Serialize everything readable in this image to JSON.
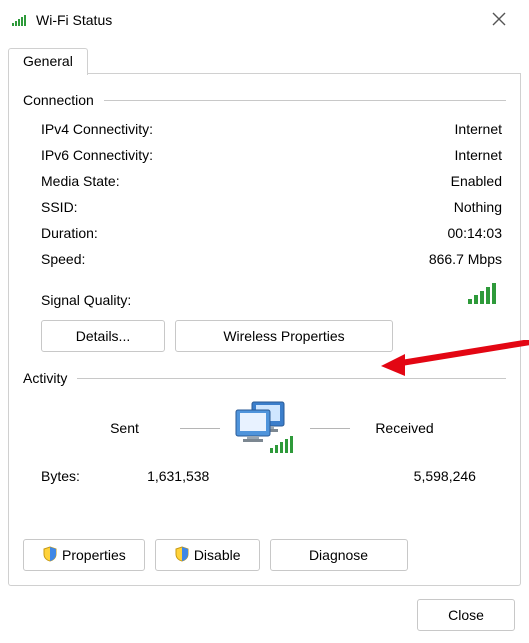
{
  "title": "Wi-Fi Status",
  "tab": "General",
  "groups": {
    "connection": "Connection",
    "activity": "Activity"
  },
  "rows": {
    "ipv4_k": "IPv4 Connectivity:",
    "ipv4_v": "Internet",
    "ipv6_k": "IPv6 Connectivity:",
    "ipv6_v": "Internet",
    "media_k": "Media State:",
    "media_v": "Enabled",
    "ssid_k": "SSID:",
    "ssid_v": "Nothing",
    "dur_k": "Duration:",
    "dur_v": "00:14:03",
    "speed_k": "Speed:",
    "speed_v": "866.7 Mbps",
    "sigq_k": "Signal Quality:"
  },
  "buttons": {
    "details": "Details...",
    "wireless": "Wireless Properties",
    "properties": "Properties",
    "disable": "Disable",
    "diagnose": "Diagnose",
    "close": "Close"
  },
  "activity": {
    "sent": "Sent",
    "received": "Received",
    "bytes_label": "Bytes:",
    "sent_bytes": "1,631,538",
    "recv_bytes": "5,598,246"
  }
}
